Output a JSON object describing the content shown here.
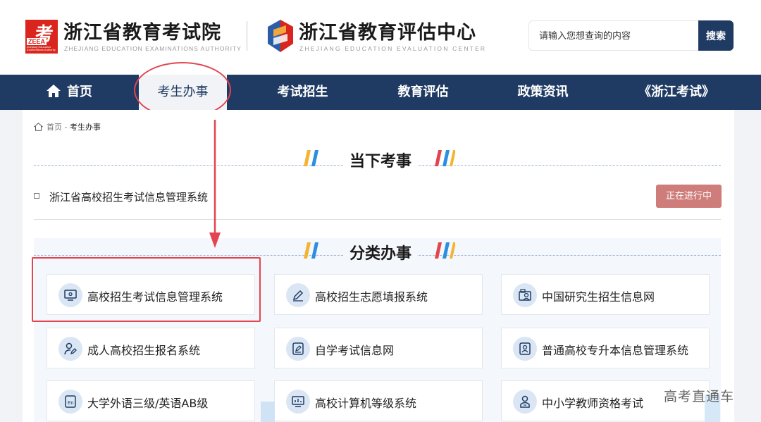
{
  "header": {
    "org1_logo_mark": "考",
    "org1_logo_abbr": "ZEEA",
    "org1_logo_tiny": "Zhejiang Education Examinations Authority",
    "org1_name": "浙江省教育考试院",
    "org1_en": "ZHEJIANG EDUCATION EXAMINATIONS AUTHORITY",
    "org2_name": "浙江省教育评估中心",
    "org2_en": "ZHEJIANG EDUCATION EVALUATION CENTER",
    "search_placeholder": "请输入您想查询的内容",
    "search_button": "搜索"
  },
  "nav": {
    "items": [
      {
        "label": "首页",
        "icon": "home-icon"
      },
      {
        "label": "考生办事",
        "active": true
      },
      {
        "label": "考试招生"
      },
      {
        "label": "教育评估"
      },
      {
        "label": "政策资讯"
      },
      {
        "label": "《浙江考试》"
      }
    ]
  },
  "breadcrumb": {
    "home": "首页",
    "separator": " - ",
    "current": "考生办事"
  },
  "current_section": {
    "title": "当下考事",
    "item_label": "浙江省高校招生考试信息管理系统",
    "status": "正在进行中"
  },
  "category_section": {
    "title": "分类办事",
    "cards": [
      {
        "label": "高校招生考试信息管理系统",
        "icon": "monitor-icon"
      },
      {
        "label": "高校招生志愿填报系统",
        "icon": "pencil-icon"
      },
      {
        "label": "中国研究生招生信息网",
        "icon": "graduate-icon"
      },
      {
        "label": "成人高校招生报名系统",
        "icon": "user-edit-icon"
      },
      {
        "label": "自学考试信息网",
        "icon": "tablet-edit-icon"
      },
      {
        "label": "普通高校专升本信息管理系统",
        "icon": "id-card-icon"
      },
      {
        "label": "大学外语三级/英语AB级",
        "icon": "english-icon"
      },
      {
        "label": "高校计算机等级系统",
        "icon": "computer-chart-icon"
      },
      {
        "label": "中小学教师资格考试",
        "icon": "teacher-icon"
      }
    ]
  },
  "watermark": "高考直通车",
  "colors": {
    "nav_bg": "#1f3b63",
    "annotation_red": "#e2454f",
    "status_badge": "#cf7d7b",
    "logo_red": "#d9251d"
  }
}
